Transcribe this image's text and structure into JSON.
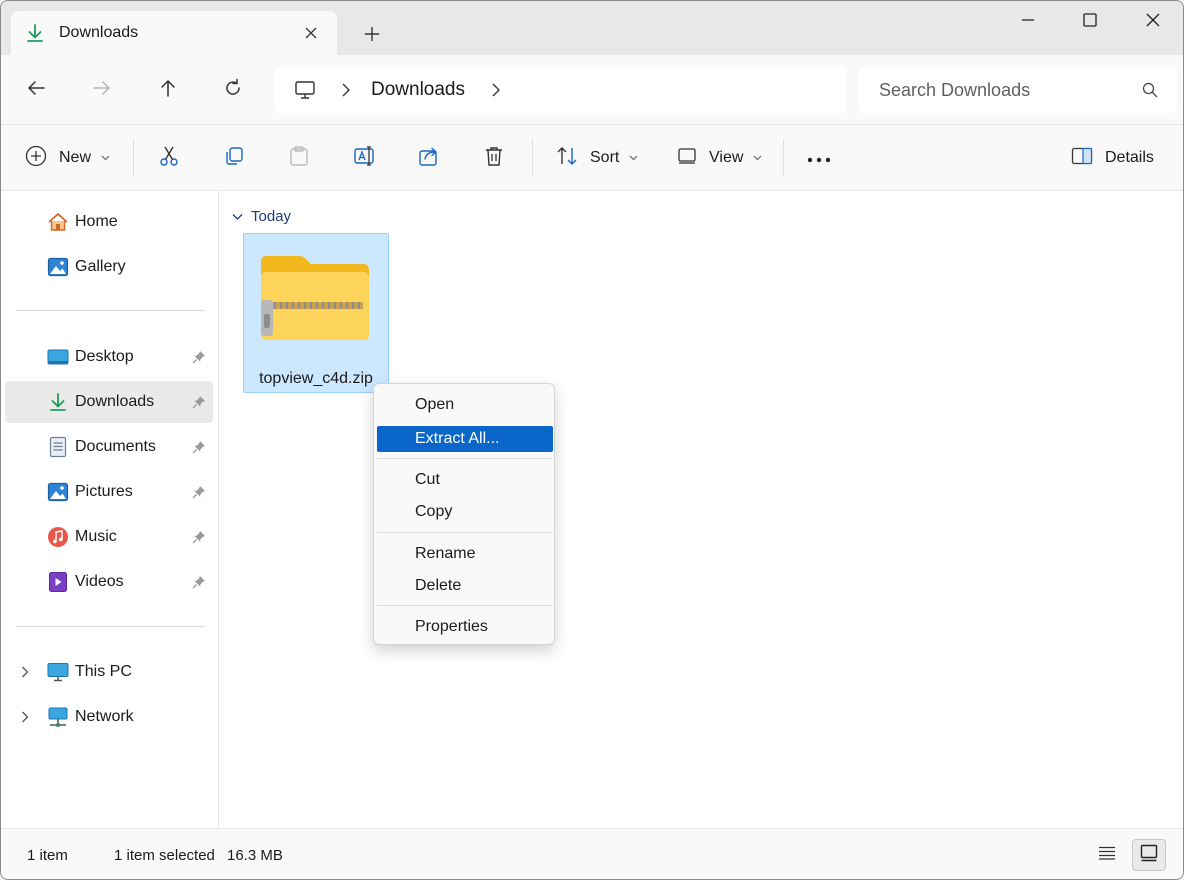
{
  "tab": {
    "label": "Downloads",
    "icon": "download-arrow-icon"
  },
  "window_controls": [
    "minimize-icon",
    "maximize-icon",
    "close-icon"
  ],
  "address": {
    "crumb": "Downloads",
    "root_icon": "this-pc-icon"
  },
  "search": {
    "placeholder": "Search Downloads"
  },
  "commands": {
    "new_label": "New",
    "sort_label": "Sort",
    "view_label": "View",
    "details_label": "Details"
  },
  "sidebar": {
    "quick": [
      {
        "label": "Home",
        "icon": "home-icon"
      },
      {
        "label": "Gallery",
        "icon": "gallery-icon"
      }
    ],
    "pinned": [
      {
        "label": "Desktop",
        "icon": "desktop-icon"
      },
      {
        "label": "Downloads",
        "icon": "downloads-icon",
        "selected": true
      },
      {
        "label": "Documents",
        "icon": "documents-icon"
      },
      {
        "label": "Pictures",
        "icon": "pictures-icon"
      },
      {
        "label": "Music",
        "icon": "music-icon"
      },
      {
        "label": "Videos",
        "icon": "videos-icon"
      }
    ],
    "devices": [
      {
        "label": "This PC",
        "icon": "this-pc-icon"
      },
      {
        "label": "Network",
        "icon": "network-icon"
      }
    ]
  },
  "content": {
    "group_label": "Today",
    "files": [
      {
        "name": "topview_c4d.zip",
        "icon": "zip-folder-icon",
        "selected": true
      }
    ]
  },
  "context_menu": {
    "items": [
      "Open",
      "Extract All...",
      "Cut",
      "Copy",
      "Rename",
      "Delete",
      "Properties"
    ],
    "highlighted": "Extract All..."
  },
  "status": {
    "count": "1 item",
    "selection": "1 item selected",
    "size": "16.3 MB"
  },
  "colors": {
    "accent": "#0a67c9",
    "selection_bg": "#cce8ff",
    "selection_border": "#99d1ff",
    "group_header": "#1c3d7a"
  }
}
